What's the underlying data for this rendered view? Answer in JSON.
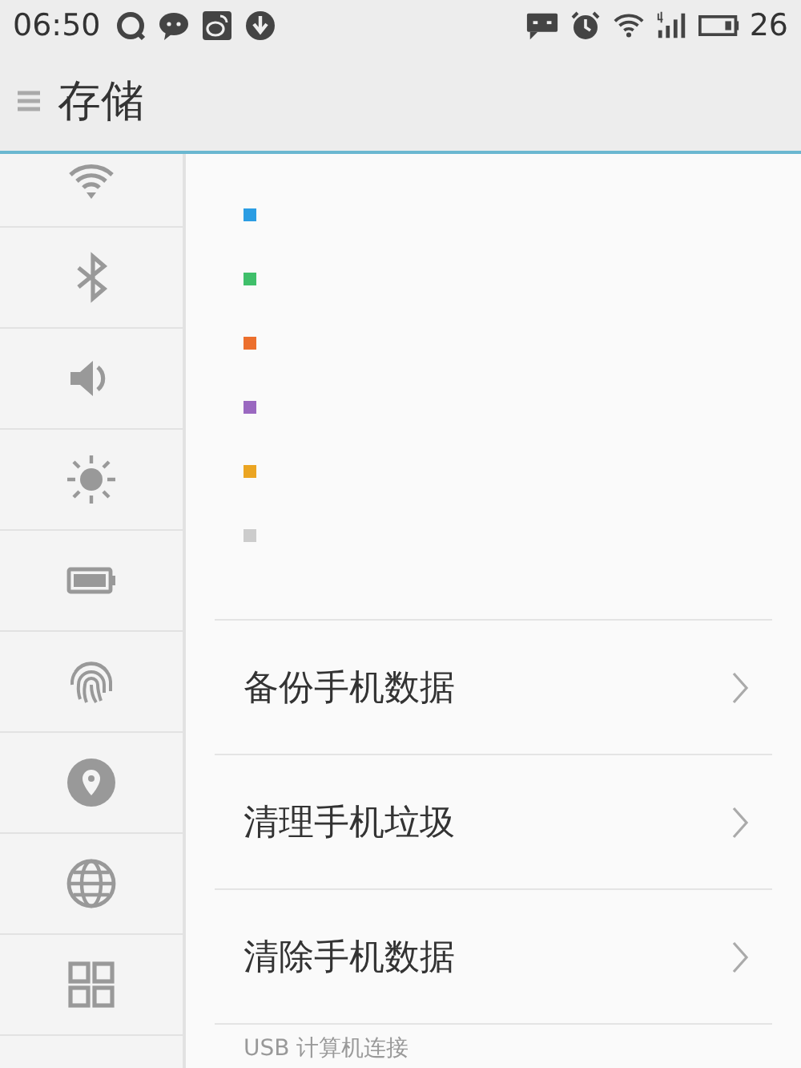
{
  "status_bar": {
    "time": "06:50",
    "battery": "26"
  },
  "header": {
    "title": "存储"
  },
  "sidebar": {
    "items": [
      {
        "kind": "wifi"
      },
      {
        "kind": "bluetooth"
      },
      {
        "kind": "volume"
      },
      {
        "kind": "brightness"
      },
      {
        "kind": "battery"
      },
      {
        "kind": "fingerprint"
      },
      {
        "kind": "location"
      },
      {
        "kind": "globe"
      },
      {
        "kind": "apps"
      }
    ]
  },
  "legend": [
    {
      "color": "#2b9de3"
    },
    {
      "color": "#3fbf6a"
    },
    {
      "color": "#ec6f2d"
    },
    {
      "color": "#9a68c0"
    },
    {
      "color": "#eba522"
    },
    {
      "color": "#cccccc"
    }
  ],
  "menu": [
    {
      "label": "备份手机数据"
    },
    {
      "label": "清理手机垃圾"
    },
    {
      "label": "清除手机数据"
    }
  ],
  "section_header": "USB 计算机连接"
}
